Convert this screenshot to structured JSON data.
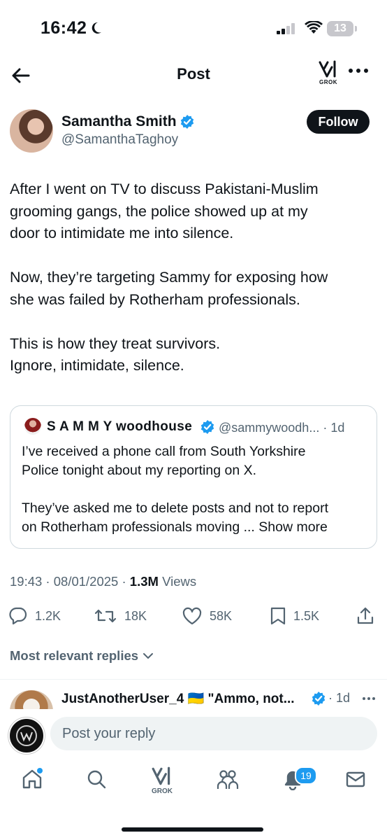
{
  "status_bar": {
    "time": "16:42",
    "battery": "13"
  },
  "header": {
    "title": "Post",
    "grok_label": "GROK"
  },
  "post": {
    "author_name": "Samantha Smith",
    "author_handle": "@SamanthaTaghoy",
    "follow_label": "Follow",
    "paragraphs": [
      [
        "After I went on TV to discuss Pakistani-Muslim",
        "grooming gangs, the police showed up at my",
        "door to intimidate me into silence."
      ],
      [
        "Now, they’re targeting Sammy for exposing how",
        "she was failed by Rotherham professionals."
      ],
      [
        "This is how they treat survivors.",
        "Ignore, intimidate, silence."
      ]
    ],
    "time": "19:43",
    "date": "08/01/2025",
    "views_count": "1.3M",
    "views_label": "Views"
  },
  "quote": {
    "name": "S A M M Y woodhouse",
    "handle": "@sammywoodh...",
    "age": "1d",
    "lines_1": [
      "I’ve received a phone call from South Yorkshire",
      "Police tonight about my reporting on X."
    ],
    "lines_2": [
      "They’ve asked me to delete posts and not to report",
      "on Rotherham professionals moving ..."
    ],
    "show_more": "Show more"
  },
  "actions": {
    "replies": "1.2K",
    "reposts": "18K",
    "likes": "58K",
    "bookmarks": "1.5K"
  },
  "replies_filter": "Most relevant replies",
  "first_reply": {
    "name": "JustAnotherUser_4",
    "flag": "🇺🇦",
    "snippet": "\"Ammo, not...",
    "age": "1d"
  },
  "reply_bar": {
    "placeholder": "Post your reply"
  },
  "bottom_nav": {
    "grok_label": "GROK",
    "notifications_badge": "19"
  }
}
